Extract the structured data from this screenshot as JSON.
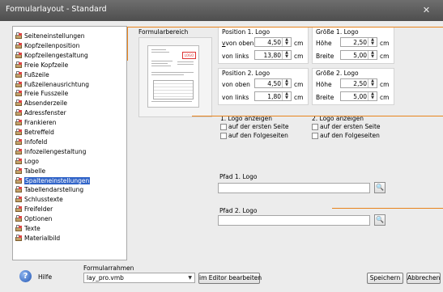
{
  "window": {
    "title": "Formularlayout - Standard",
    "close_glyph": "✕"
  },
  "tree": {
    "selected_index": 15,
    "items": [
      "Seiteneinstellungen",
      "Kopfzeilenposition",
      "Kopfzeilengestaltung",
      "Freie Kopfzeile",
      "Fußzeile",
      "Fußzeilenausrichtung",
      "Freie Fusszeile",
      "Absenderzeile",
      "Adressfenster",
      "Frankieren",
      "Betreffeld",
      "Infofeld",
      "Infozeilengestaltung",
      "Logo",
      "Tabelle",
      "Spalteneinstellungen",
      "Tabellendarstellung",
      "Schlusstexte",
      "Freifelder",
      "Optionen",
      "Texte",
      "Materialbild"
    ],
    "icon": "form-section-icon"
  },
  "preview": {
    "label": "Formularbereich",
    "logo_text": "LOGO"
  },
  "logo1": {
    "position_title": "Position 1. Logo",
    "top_label_pre": "von oben",
    "top_value": "4,50",
    "left_label_pre": "von links",
    "left_value": "13,80",
    "size_title": "Größe 1. Logo",
    "height_label": "Höhe",
    "height_value": "2,50",
    "width_label": "Breite",
    "width_value": "5,00"
  },
  "logo2": {
    "position_title": "Position 2. Logo",
    "top_label": "von oben",
    "top_value": "4,50",
    "left_label": "von links",
    "left_value": "1,80",
    "size_title": "Größe 2. Logo",
    "height_label": "Höhe",
    "height_value": "2,50",
    "width_label": "Breite",
    "width_value": "5,00"
  },
  "unit": "cm",
  "show1": {
    "title": "1. Logo anzeigen",
    "first_page": "auf der ersten Seite",
    "following": "auf den Folgeseiten"
  },
  "show2": {
    "title": "2. Logo anzeigen",
    "first_page": "auf der ersten Seite",
    "following": "auf den Folgeseiten"
  },
  "path1": {
    "label": "Pfad 1. Logo",
    "value": ""
  },
  "path2": {
    "label": "Pfad 2. Logo",
    "value": ""
  },
  "bottom": {
    "help_label": "Hilfe",
    "frame_label": "Formularrahmen",
    "frame_value": "lay_pro.vmb",
    "editor_button": "im Editor bearbeiten",
    "save_button": "Speichern",
    "cancel_button": "Abbrechen"
  },
  "colors": {
    "accent": "#e8831c",
    "selection": "#3164c8",
    "titlebar": "#5a5a5a"
  }
}
